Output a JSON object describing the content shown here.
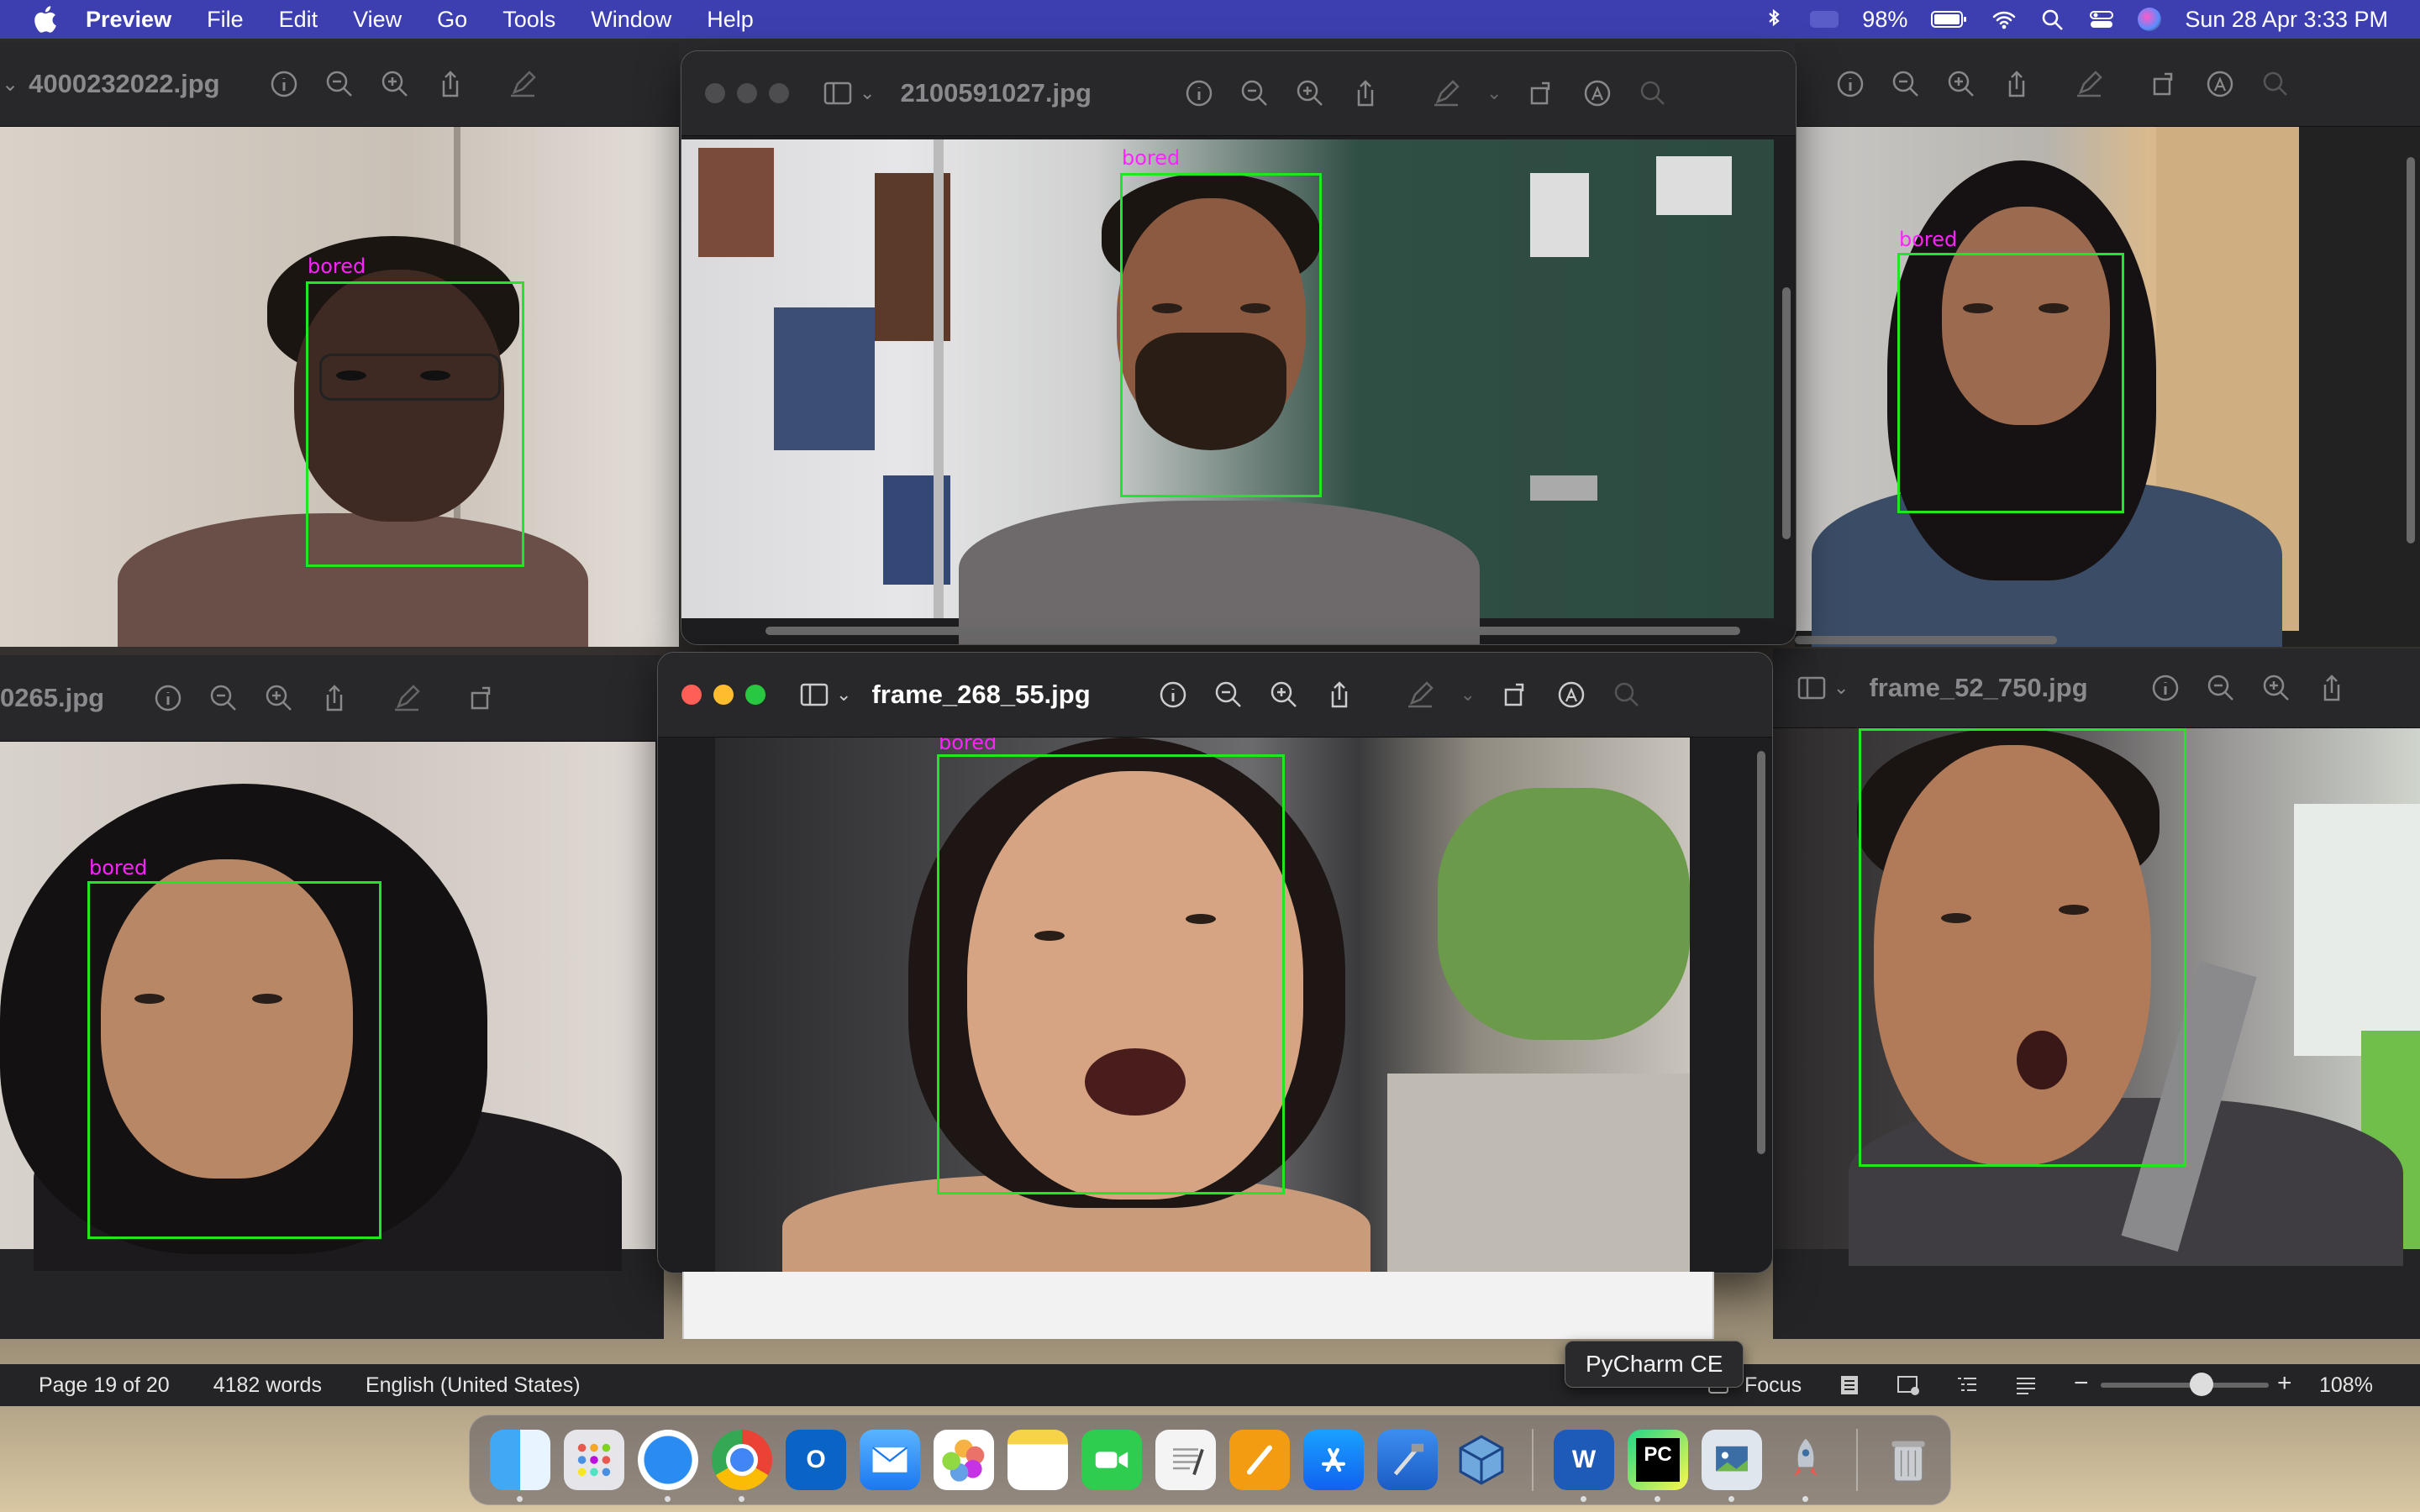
{
  "menubar": {
    "app_name": "Preview",
    "items": [
      "File",
      "Edit",
      "View",
      "Go",
      "Tools",
      "Window",
      "Help"
    ],
    "battery": "98%",
    "datetime": "Sun 28 Apr  3:33 PM"
  },
  "windows": [
    {
      "title": "4000232022.jpg",
      "label": "bored"
    },
    {
      "title": "2100591027.jpg",
      "label": "bored"
    },
    {
      "title": "",
      "label": "bored"
    },
    {
      "title": "0265.jpg",
      "label": "bored"
    },
    {
      "title": "frame_268_55.jpg",
      "label": "bored"
    },
    {
      "title": "frame_52_750.jpg",
      "label": "bored"
    }
  ],
  "word_status": {
    "page": "Page 19 of 20",
    "words": "4182 words",
    "language": "English (United States)",
    "focus": "Focus",
    "zoom": "108%",
    "zoom_level": 0.6
  },
  "dock": {
    "tooltip": "PyCharm CE",
    "apps": [
      "Finder",
      "Launchpad",
      "Safari",
      "Chrome",
      "Outlook",
      "Mail",
      "Photos",
      "Notes",
      "FaceTime",
      "TextEdit",
      "Pages",
      "App Store",
      "Xcode",
      "VirtualBox",
      "Word",
      "PyCharm CE",
      "Preview",
      "Rocket",
      "Trash"
    ],
    "pycharm_label": "PC",
    "word_label": "W"
  },
  "colors": {
    "menubar": "#3d3fb0",
    "face_box": "#22e622",
    "face_label": "#ff22ff"
  }
}
